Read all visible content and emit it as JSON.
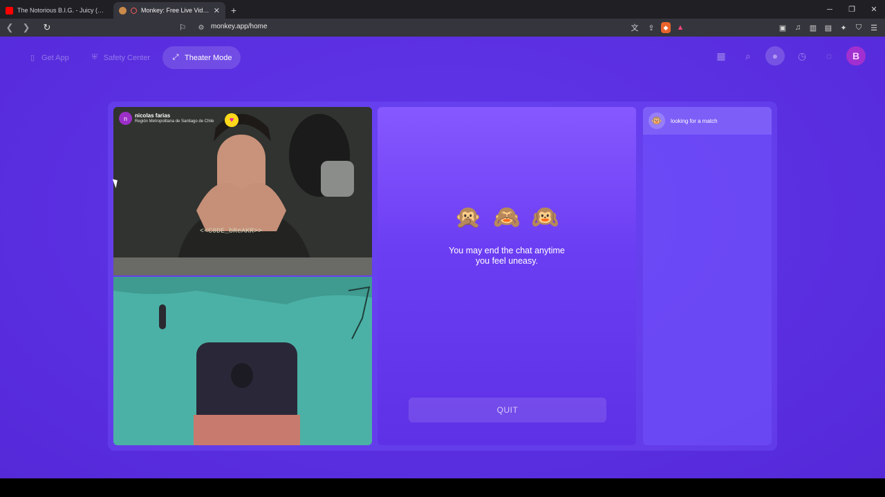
{
  "browser": {
    "tabs": [
      {
        "title": "The Notorious B.I.G. - Juicy (Official V",
        "active": false,
        "favicon": "youtube-icon"
      },
      {
        "title": "Monkey: Free Live Video Chat",
        "active": true,
        "favicon": "monkey-icon"
      }
    ],
    "new_tab": "+",
    "url": "monkey.app/home",
    "window_controls": {
      "minimize": "─",
      "restore": "❐",
      "close": "✕"
    }
  },
  "nav": {
    "get_app": "Get App",
    "safety_center": "Safety Center",
    "theater_mode": "Theater Mode"
  },
  "video": {
    "remote_user": {
      "initial": "n",
      "name": "nicolas farias",
      "location": "Región Metropolitana de Santiago de Chile"
    }
  },
  "center": {
    "monkeys": [
      "🙊",
      "🙈",
      "🙉"
    ],
    "message_line1": "You may end the chat anytime",
    "message_line2": "you feel uneasy.",
    "quit_label": "QUIT"
  },
  "chat": {
    "status": "looking for a match"
  },
  "profile": {
    "initial": "B"
  },
  "colors": {
    "page_bg": "#5a2fe0",
    "center_panel": "#7a4cff",
    "avatar": "#a22fcf",
    "heart_badge": "#ffd91a"
  }
}
